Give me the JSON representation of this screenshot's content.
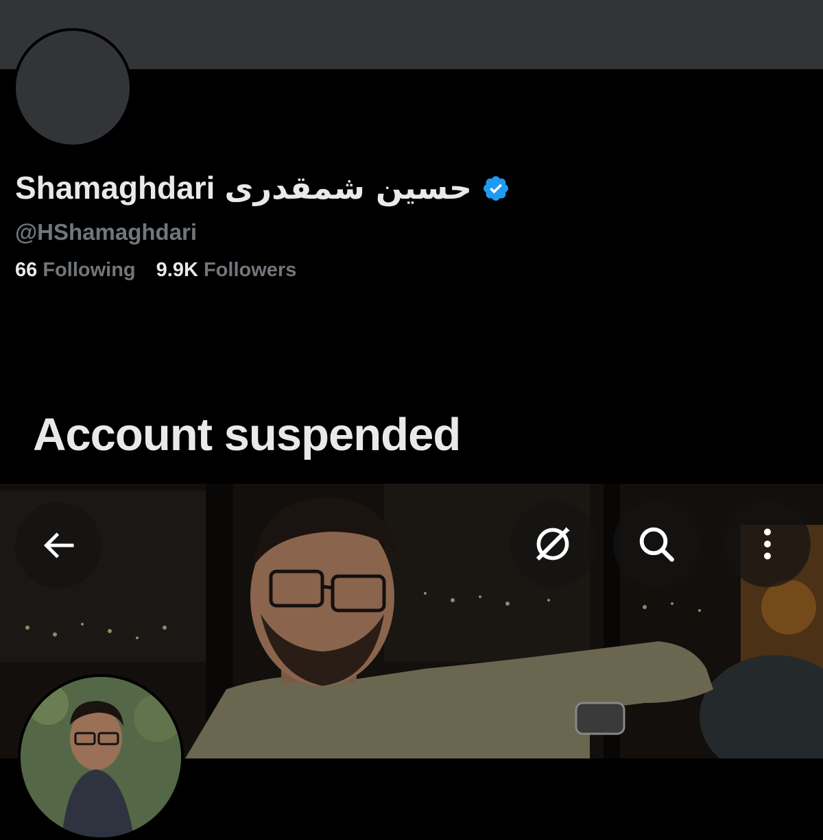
{
  "profile": {
    "name_latin": "Shamaghdari",
    "name_arabic": "حسین شمقدری",
    "handle": "@HShamaghdari",
    "following_count": "66",
    "following_label": "Following",
    "followers_count": "9.9K",
    "followers_label": "Followers",
    "verified": true
  },
  "status": {
    "message": "Account suspended"
  },
  "toolbar": {
    "back_icon": "arrow-left-icon",
    "grok_icon": "grok-icon",
    "search_icon": "search-icon",
    "more_icon": "more-vertical-icon"
  },
  "colors": {
    "background": "#000000",
    "banner": "#333438",
    "text_primary": "#e7e9ea",
    "text_secondary": "#71767b",
    "verified": "#1d9bf0"
  }
}
